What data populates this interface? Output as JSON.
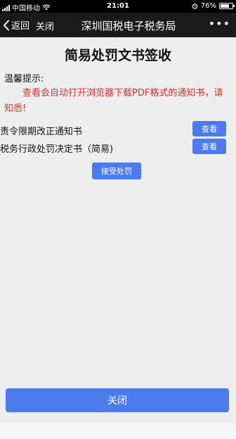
{
  "status_bar": {
    "carrier": "中国移动",
    "time": "21:01",
    "battery_level": 0.76,
    "battery_text": "76%",
    "icons": [
      "signal-icon",
      "wifi-icon",
      "alarm-icon",
      "battery-icon"
    ]
  },
  "nav": {
    "back_label": "返回",
    "close_label": "关闭",
    "title": "深圳国税电子税务局",
    "more_label": "•••"
  },
  "page": {
    "title": "简易处罚文书签收",
    "tip_label": "温馨提示:",
    "tip_text": "查看会自动打开浏览器下载PDF格式的通知书，请知悉!"
  },
  "documents": [
    {
      "name": "责令限期改正通知书",
      "button": "查看"
    },
    {
      "name": "税务行政处罚决定书（简易)",
      "button": "查看"
    }
  ],
  "actions": {
    "accept_label": "接受处罚",
    "close_label": "关闭"
  },
  "colors": {
    "accent": "#4a7cf0",
    "tip_text": "#d9302b",
    "navbar": "#1a1a1a",
    "background": "#eeeeee"
  }
}
